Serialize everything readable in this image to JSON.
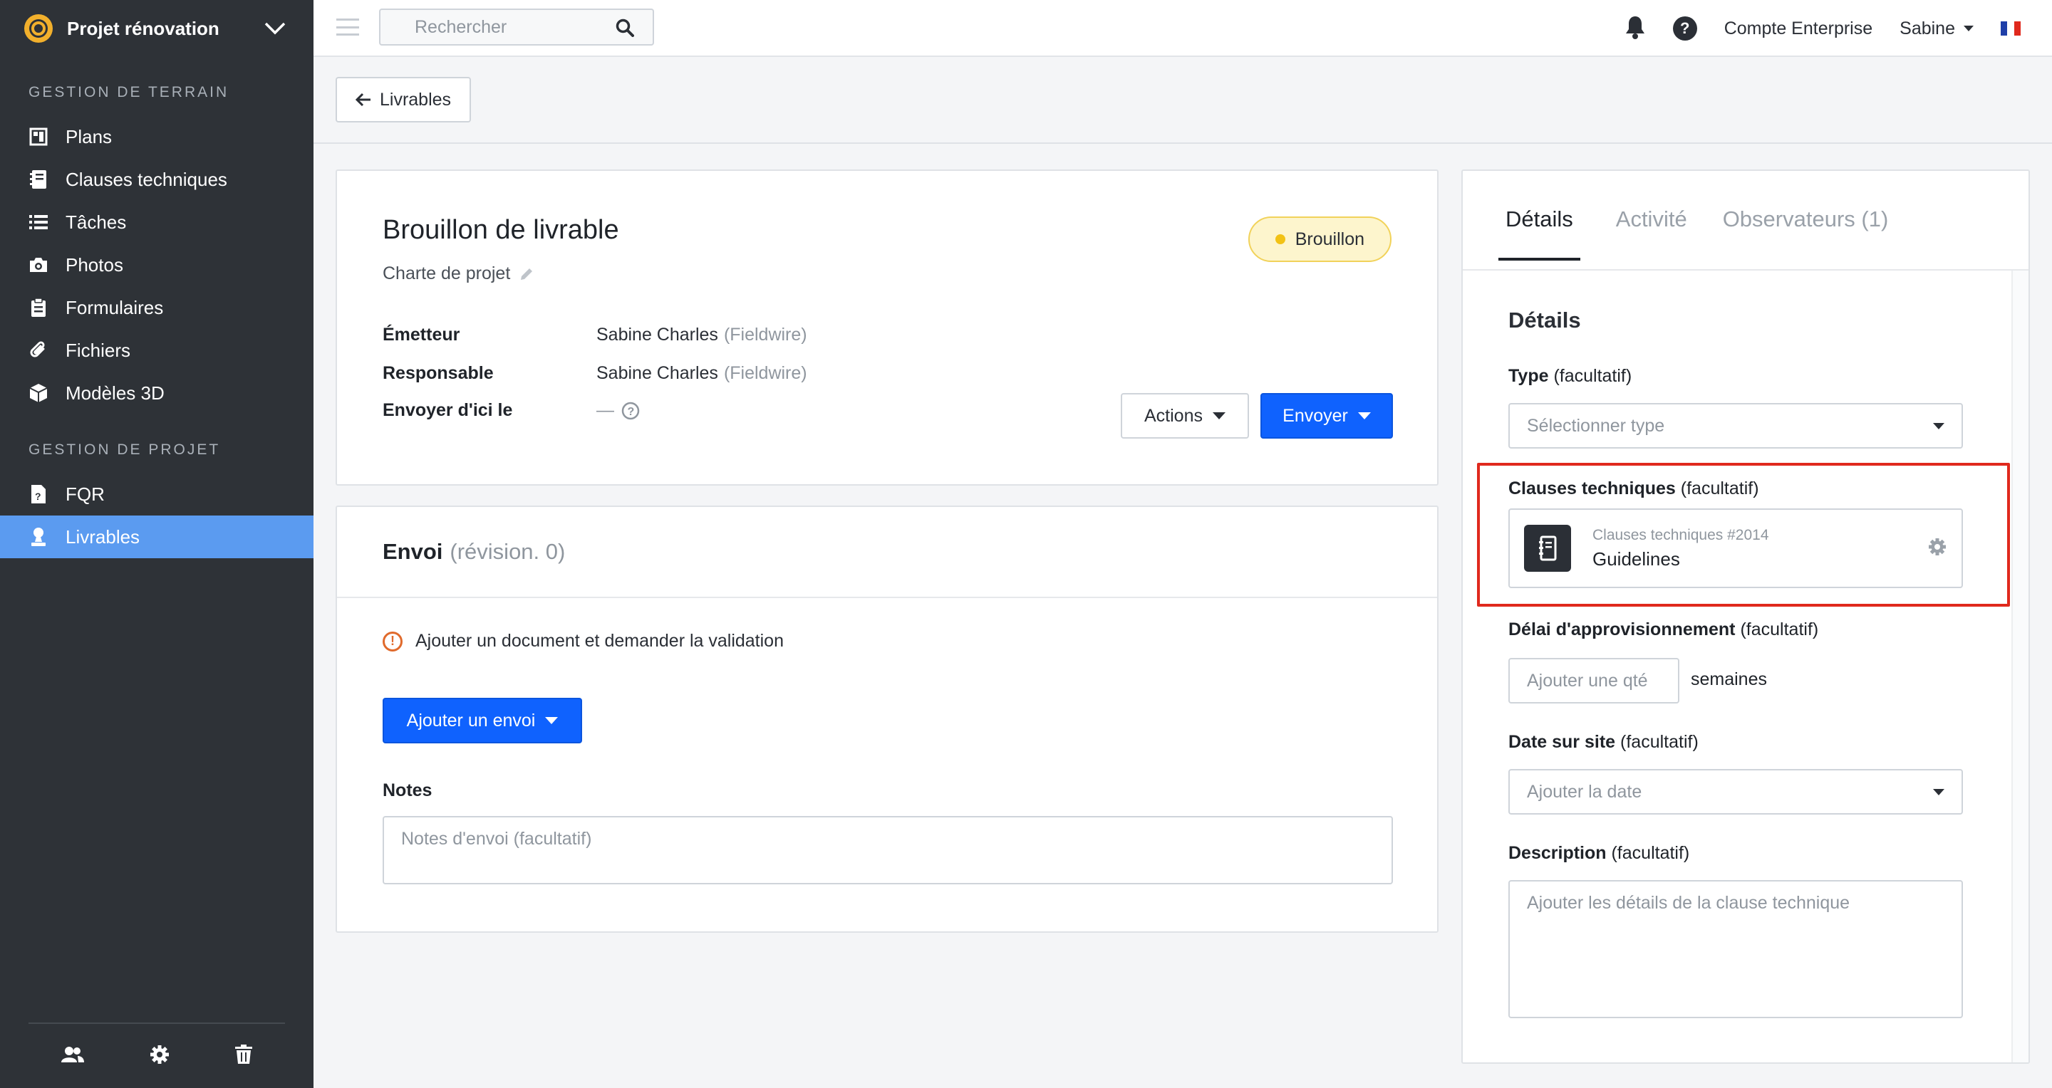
{
  "project": {
    "name": "Projet rénovation"
  },
  "sidebar": {
    "section_field": "GESTION DE TERRAIN",
    "section_project": "GESTION DE PROJET",
    "items_field": [
      {
        "label": "Plans",
        "icon": "plans-icon"
      },
      {
        "label": "Clauses techniques",
        "icon": "spec-book-icon"
      },
      {
        "label": "Tâches",
        "icon": "list-icon"
      },
      {
        "label": "Photos",
        "icon": "camera-icon"
      },
      {
        "label": "Formulaires",
        "icon": "clipboard-icon"
      },
      {
        "label": "Fichiers",
        "icon": "paperclip-icon"
      },
      {
        "label": "Modèles 3D",
        "icon": "cube-icon"
      }
    ],
    "items_project": [
      {
        "label": "FQR",
        "icon": "document-icon"
      },
      {
        "label": "Livrables",
        "icon": "user-stamp-icon",
        "active": true
      }
    ]
  },
  "topbar": {
    "search_placeholder": "Rechercher",
    "account": "Compte Enterprise",
    "user": "Sabine",
    "help": "?"
  },
  "subheader": {
    "back_label": "Livrables"
  },
  "submittal": {
    "title": "Brouillon de livrable",
    "subtitle": "Charte de projet",
    "status": "Brouillon",
    "fields": {
      "issuer_label": "Émetteur",
      "issuer_name": "Sabine Charles",
      "issuer_org": "(Fieldwire)",
      "responsible_label": "Responsable",
      "responsible_name": "Sabine Charles",
      "responsible_org": "(Fieldwire)",
      "due_label": "Envoyer d'ici le",
      "due_value": "—"
    },
    "actions_label": "Actions",
    "send_label": "Envoyer"
  },
  "envoi": {
    "title": "Envoi",
    "revision": "(révision. 0)",
    "warning": "Ajouter un document et demander la validation",
    "add_button": "Ajouter un envoi",
    "notes_label": "Notes",
    "notes_placeholder": "Notes d'envoi (facultatif)"
  },
  "panel": {
    "tabs": [
      "Détails",
      "Activité",
      "Observateurs (1)"
    ],
    "heading": "Détails",
    "optional": "(facultatif)",
    "type_label": "Type",
    "type_placeholder": "Sélectionner type",
    "spec_label": "Clauses techniques",
    "spec_number": "Clauses techniques #2014",
    "spec_name": "Guidelines",
    "lead_label": "Délai d'approvisionnement",
    "lead_placeholder": "Ajouter une qté",
    "lead_unit": "semaines",
    "date_label": "Date sur site",
    "date_placeholder": "Ajouter la date",
    "desc_label": "Description",
    "desc_placeholder": "Ajouter les détails de la clause technique"
  },
  "colors": {
    "sidebar_bg": "#2e3237",
    "active_item": "#5b9bf0",
    "primary": "#0f62fe",
    "status_bg": "#fdf5cd",
    "highlight": "#e0291d"
  }
}
